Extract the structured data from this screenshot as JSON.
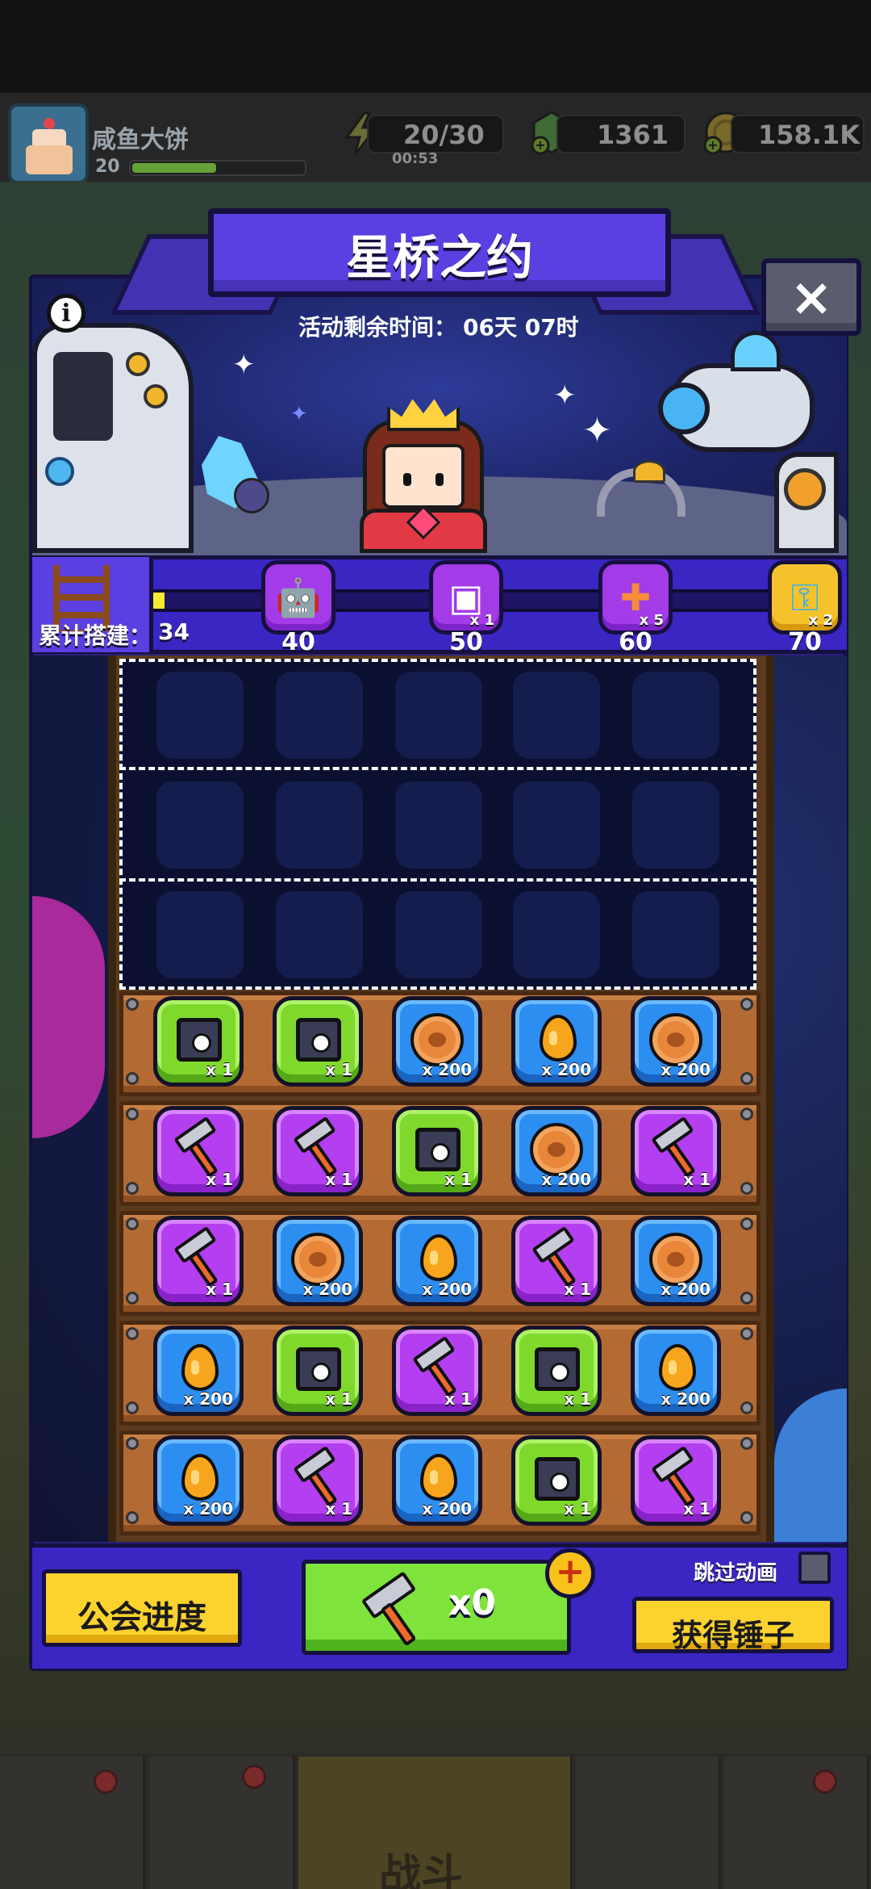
{
  "player": {
    "name": "咸鱼大饼",
    "level": "20",
    "xp_fraction": 0.48
  },
  "resources": {
    "energy": {
      "value": "20/30",
      "timer": "00:53",
      "icon": "lightning-icon"
    },
    "gems": {
      "value": "1361",
      "icon": "green-gem-icon"
    },
    "coins": {
      "value": "158.1K",
      "icon": "gold-coin-icon"
    }
  },
  "event": {
    "title": "星桥之约",
    "timer_label": "活动剩余时间：",
    "timer_value": "06天 07时",
    "close_glyph": "×",
    "info_glyph": "i"
  },
  "progress": {
    "label": "累计搭建：",
    "value": "34",
    "fill_fraction": 0.02,
    "milestones": [
      {
        "threshold": "40",
        "reward": "s-rank-robot-icon",
        "qty": ""
      },
      {
        "threshold": "50",
        "reward": "purple-chest-icon",
        "qty": "x 1"
      },
      {
        "threshold": "60",
        "reward": "puzzle-piece-icon",
        "qty": "x 5"
      },
      {
        "threshold": "70",
        "reward": "gold-key-icon",
        "qty": "x 2"
      }
    ]
  },
  "board": {
    "rows": [
      [
        {
          "type": "chest",
          "color": "green",
          "qty": "x 1"
        },
        {
          "type": "chest",
          "color": "green",
          "qty": "x 1"
        },
        {
          "type": "coin",
          "color": "blue",
          "qty": "x 200"
        },
        {
          "type": "drop",
          "color": "blue",
          "qty": "x 200"
        },
        {
          "type": "coin",
          "color": "blue",
          "qty": "x 200"
        }
      ],
      [
        {
          "type": "hammer",
          "color": "purple",
          "qty": "x 1"
        },
        {
          "type": "hammer",
          "color": "purple",
          "qty": "x 1"
        },
        {
          "type": "chest",
          "color": "green",
          "qty": "x 1"
        },
        {
          "type": "coin",
          "color": "blue",
          "qty": "x 200"
        },
        {
          "type": "hammer",
          "color": "purple",
          "qty": "x 1"
        }
      ],
      [
        {
          "type": "hammer",
          "color": "purple",
          "qty": "x 1"
        },
        {
          "type": "coin",
          "color": "blue",
          "qty": "x 200"
        },
        {
          "type": "drop",
          "color": "blue",
          "qty": "x 200"
        },
        {
          "type": "hammer",
          "color": "purple",
          "qty": "x 1"
        },
        {
          "type": "coin",
          "color": "blue",
          "qty": "x 200"
        }
      ],
      [
        {
          "type": "drop",
          "color": "blue",
          "qty": "x 200"
        },
        {
          "type": "chest",
          "color": "green",
          "qty": "x 1"
        },
        {
          "type": "hammer",
          "color": "purple",
          "qty": "x 1"
        },
        {
          "type": "chest",
          "color": "green",
          "qty": "x 1"
        },
        {
          "type": "drop",
          "color": "blue",
          "qty": "x 200"
        }
      ],
      [
        {
          "type": "drop",
          "color": "blue",
          "qty": "x 200"
        },
        {
          "type": "hammer",
          "color": "purple",
          "qty": "x 1"
        },
        {
          "type": "drop",
          "color": "blue",
          "qty": "x 200"
        },
        {
          "type": "chest",
          "color": "green",
          "qty": "x 1"
        },
        {
          "type": "hammer",
          "color": "purple",
          "qty": "x 1"
        }
      ]
    ]
  },
  "controls": {
    "guild_progress": "公会进度",
    "hammer_count": "x0",
    "plus_glyph": "+",
    "skip_animation": "跳过动画",
    "get_hammer": "获得锤子"
  },
  "nav": {
    "battle_label": "战斗",
    "items": [
      "shop-icon",
      "guild-shield-icon",
      "battle-star-icon",
      "planet-icon",
      "dna-icon"
    ]
  },
  "colors": {
    "modal": "#2a1f7c",
    "title_plate": "#5b3fe0",
    "tile_green": "#7fd92d",
    "tile_blue": "#2d8ef2",
    "tile_purple": "#b43ff0",
    "button_yellow": "#fcd22e",
    "button_green": "#7ee33a"
  }
}
